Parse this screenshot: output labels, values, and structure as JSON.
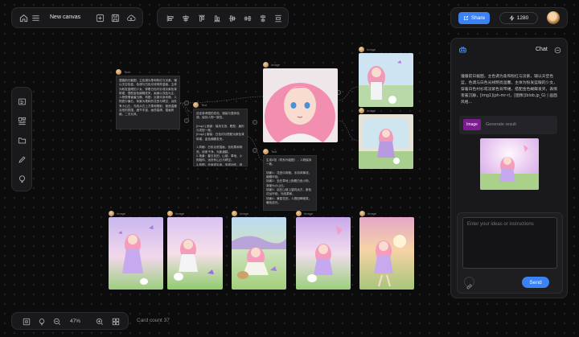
{
  "top_bar": {
    "canvas_name": "New canvas"
  },
  "right_bar": {
    "share_label": "Share",
    "credits": "1280"
  },
  "zoom_bar": {
    "zoom": "47%",
    "card_count": "Card count 37"
  },
  "chat": {
    "title": "Chat",
    "message": "遵循前日截图，主色调为柔和粉红与淡紫，辅以天空色蓝，色调与白色光线明亮温馨，主体为粉发蓝眼的少女，穿着白色衬衫或淡紫色背带裙，搭配金色蝴蝶发夹，表情害羞沉静，[img1](ph-mr-r)，[图像](blob.jp_G) | 画面风格...",
    "attachment_badge": "Image",
    "attachment_label": "Generate result",
    "input_placeholder": "Enter your ideas or instructions",
    "send_label": "Send"
  },
  "nodes": {
    "text1": {
      "label": "Text",
      "content": "遵循前日截图，主色调为柔和粉红与淡紫，辅以天空色蓝，色调与白色光线明亮温馨，主体为粉发蓝眼的少女，穿着白色衬衫或淡紫色背带裙，搭配金色蝴蝶发夹，画面以浅色为主，人物表情害羞沉静。构图：近景半身肖像，人物居中偏右，背景为柔和的花田与晴空，远处有小山丘，光线从右上方柔和照射，营造温暖治愈的氛围，细节丰富，画质高清，插画风格，二次元风。"
    },
    "text2": {
      "label": "Text",
      "content": "设定参考图的发色、服装与整体色调，保持人物一致性。\n\n[img1] 面部：保持五官、眼型、眉形与发型一致。\n[img2] 服装：白色衬衫搭配淡紫色背带裙，金色蝴蝶发夹。\n\n1.风格：日系治愈插画，色彩柔和明亮，线条干净，光影细腻。\n2.场景：春日花田、山坡、草地、小狗陪伴，远处有山丘与晴空。\n3.构图：全身或半身，多样动作，奔跑、坐姿、放风筝、抱小狗。\n4.光线：暖色逆光与柔和侧光，营造梦幻氛围。"
    },
    "text3": {
      "label": "Text",
      "content": "生成4张（同系列组图），人物保持一致。\n\n场景1：花田中奔跑，手持风筝线，蝴蝶环绕。\n场景2：坐在草地上抱着白色小狗，背景为小山丘。\n场景3：站在山坡上望向远方，紫色花丛环绕，光线柔和。\n场景4：黄昏花田，人物回眸微笑，暖色逆光。\n\n\"生成要求：保持发色、服装、发夹一致，画面风格统一。\""
    },
    "image_labels": {
      "portrait": "Image",
      "top_right_1": "Image",
      "top_right_2": "Image",
      "bottom_1": "Image",
      "bottom_2": "Image",
      "bottom_3": "Image",
      "bottom_4": "Image",
      "bottom_5": "Image"
    }
  },
  "icons": {
    "home": "home-icon",
    "menu": "menu-icon",
    "undo": "undo-icon",
    "save": "save-icon",
    "cloud": "cloud-upload-icon",
    "flash": "lightning-icon"
  },
  "colors": {
    "accent": "#3b82f6",
    "badge": "#7b1d8f",
    "background": "#0c0c0d"
  }
}
